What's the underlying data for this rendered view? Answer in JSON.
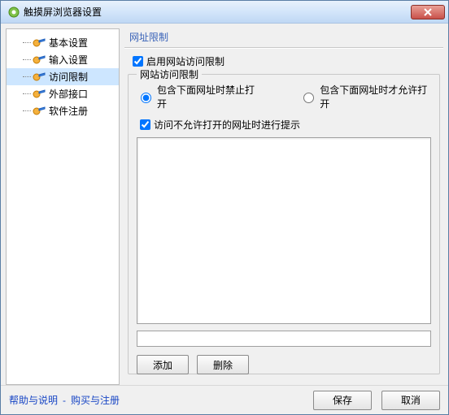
{
  "window": {
    "title": "触摸屏浏览器设置"
  },
  "sidebar": {
    "items": [
      {
        "label": "基本设置"
      },
      {
        "label": "输入设置"
      },
      {
        "label": "访问限制"
      },
      {
        "label": "外部接口"
      },
      {
        "label": "软件注册"
      }
    ],
    "selected_index": 2
  },
  "panel": {
    "title": "网址限制",
    "enable_label": "启用网站访问限制",
    "enable_checked": true,
    "group_title": "网站访问限制",
    "radio_deny_label": "包含下面网址时禁止打开",
    "radio_allow_label": "包含下面网址时才允许打开",
    "radio_selected": "deny",
    "prompt_label": "访问不允许打开的网址时进行提示",
    "prompt_checked": true,
    "url_input_value": "",
    "add_label": "添加",
    "delete_label": "删除"
  },
  "footer": {
    "help_label": "帮助与说明",
    "buy_label": "购买与注册",
    "save_label": "保存",
    "cancel_label": "取消"
  }
}
